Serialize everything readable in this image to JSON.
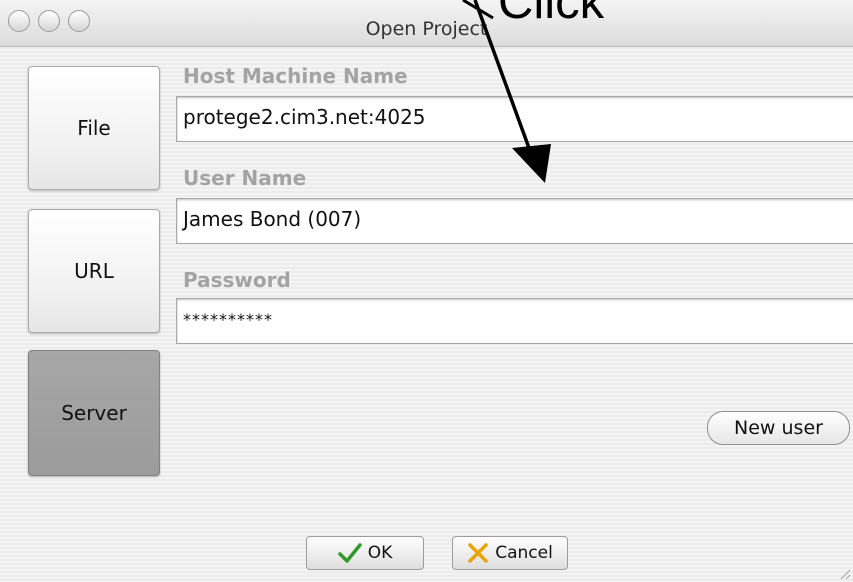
{
  "window": {
    "title": "Open Project"
  },
  "annotation": {
    "text": "Click"
  },
  "sidebar": {
    "items": [
      {
        "label": "File",
        "selected": false
      },
      {
        "label": "URL",
        "selected": false
      },
      {
        "label": "Server",
        "selected": true
      }
    ]
  },
  "form": {
    "host_label": "Host Machine Name",
    "host_value": "protege2.cim3.net:4025",
    "user_label": "User Name",
    "user_value": "James Bond (007)",
    "password_label": "Password",
    "password_value": "**********"
  },
  "buttons": {
    "new_user": "New user",
    "ok": "OK",
    "cancel": "Cancel"
  },
  "colors": {
    "ok_check": "#2f9a2a",
    "cancel_x": "#e8a400",
    "selected_tab": "#a3a3a3"
  }
}
